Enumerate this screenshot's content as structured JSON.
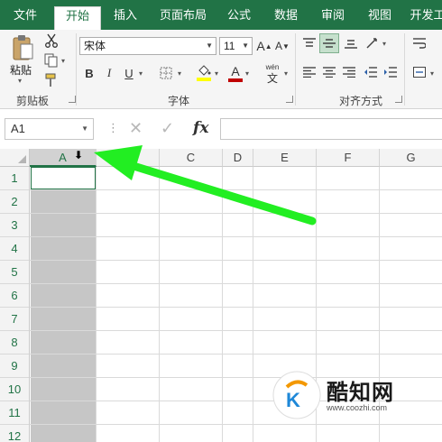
{
  "ribbon": {
    "tabs": [
      {
        "label": "文件"
      },
      {
        "label": "开始"
      },
      {
        "label": "插入"
      },
      {
        "label": "页面布局"
      },
      {
        "label": "公式"
      },
      {
        "label": "数据"
      },
      {
        "label": "审阅"
      },
      {
        "label": "视图"
      },
      {
        "label": "开发工"
      }
    ],
    "clipboard": {
      "paste_label": "粘贴",
      "group_label": "剪贴板"
    },
    "font": {
      "font_name": "宋体",
      "font_size": "11",
      "bold": "B",
      "italic": "I",
      "underline": "U",
      "grow": "A",
      "shrink": "A",
      "phonetic_top": "wén",
      "phonetic_bottom": "文",
      "font_color_letter": "A",
      "group_label": "字体",
      "highlight_color": "#ffff00",
      "font_color": "#c00000"
    },
    "alignment": {
      "group_label": "对齐方式"
    }
  },
  "formula_bar": {
    "name_box": "A1",
    "separator": "⋮",
    "cancel": "✕",
    "enter": "✓",
    "fx": "fx",
    "value": ""
  },
  "sheet": {
    "columns": [
      "A",
      "B",
      "C",
      "D",
      "E",
      "F",
      "G"
    ],
    "rows": [
      "1",
      "2",
      "3",
      "4",
      "5",
      "6",
      "7",
      "8",
      "9",
      "10",
      "11",
      "12"
    ],
    "selected_column": "A",
    "active_cell": "A1",
    "accent": "#217346"
  },
  "annotation": {
    "arrow_color": "#22ee22"
  },
  "watermark": {
    "title": "酷知网",
    "url": "www.coozhi.com"
  }
}
